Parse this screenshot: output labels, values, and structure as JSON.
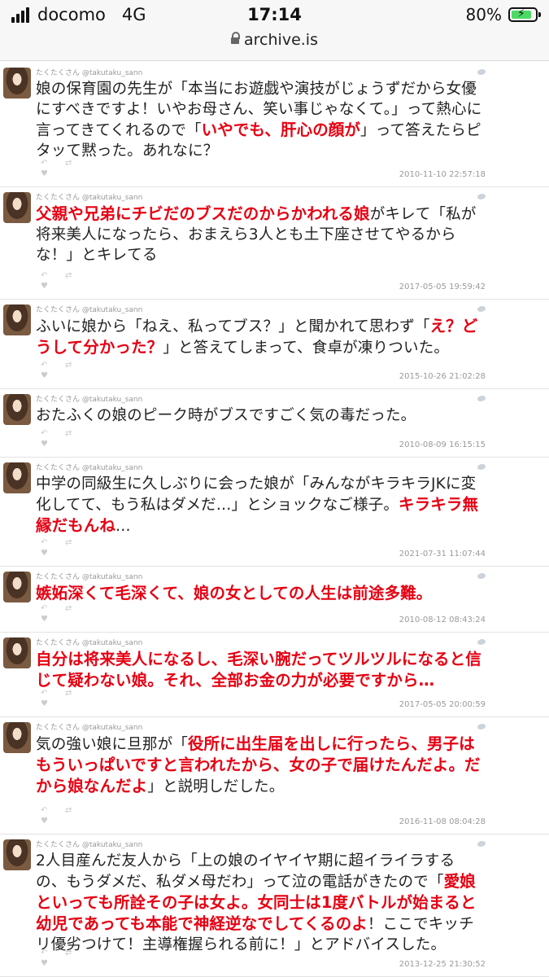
{
  "status": {
    "carrier": "docomo",
    "network": "4G",
    "time": "17:14",
    "battery": "80%"
  },
  "url": "archive.is",
  "author": "たくたくさん @takutaku_sann",
  "tweets": [
    {
      "segments": [
        {
          "t": "娘の保育園の先生が「本当にお遊戯や演技がじょうずだから女優にすべきですよ！いやお母さん、笑い事じゃなくて。」って熱心に言ってきてくれるので「",
          "r": false
        },
        {
          "t": "いやでも、肝心の顔が",
          "r": true
        },
        {
          "t": "」って答えたらピタッて黙った。あれなに？",
          "r": false
        }
      ],
      "time": "2010-11-10 22:57:18"
    },
    {
      "segments": [
        {
          "t": "父親や兄弟にチビだのブスだのからかわれる娘",
          "r": true
        },
        {
          "t": "がキレて「私が将来美人になったら、おまえら3人とも土下座させてやるからな！」とキレてる",
          "r": false
        }
      ],
      "time": "2017-05-05 19:59:42"
    },
    {
      "segments": [
        {
          "t": "ふいに娘から「ねえ、私ってブス？」と聞かれて思わず「",
          "r": false
        },
        {
          "t": "え？どうして分かった？",
          "r": true
        },
        {
          "t": "」と答えてしまって、食卓が凍りついた。",
          "r": false
        }
      ],
      "time": "2015-10-26 21:02:28"
    },
    {
      "segments": [
        {
          "t": "おたふくの娘のピーク時がブスですごく気の毒だった。",
          "r": false
        }
      ],
      "time": "2010-08-09 16:15:15"
    },
    {
      "segments": [
        {
          "t": "中学の同級生に久しぶりに会った娘が「みんながキラキラJKに変化してて、もう私はダメだ…」とショックなご様子。",
          "r": false
        },
        {
          "t": "キラキラ無縁だもんね",
          "r": true
        },
        {
          "t": "…",
          "r": false
        }
      ],
      "time": "2021-07-31 11:07:44"
    },
    {
      "segments": [
        {
          "t": "嫉妬深くて毛深くて、娘の女としての人生は前途多難。",
          "r": true
        }
      ],
      "time": "2010-08-12 08:43:24"
    },
    {
      "segments": [
        {
          "t": "自分は将来美人になるし、毛深い腕だってツルツルになると信じて疑わない娘。それ、全部お金の力が必要ですから…",
          "r": true
        }
      ],
      "time": "2017-05-05 20:00:59"
    },
    {
      "segments": [
        {
          "t": "気の強い娘に旦那が「",
          "r": false
        },
        {
          "t": "役所に出生届を出しに行ったら、男子はもういっぱいですと言われたから、女の子で届けたんだよ。だから娘なんだよ",
          "r": true
        },
        {
          "t": "」と説明しだした。",
          "r": false
        }
      ],
      "time": "2016-11-08 08:04:28"
    },
    {
      "segments": [
        {
          "t": "2人目産んだ友人から「上の娘のイヤイヤ期に超イライラするの、もうダメだ、私ダメ母だわ」って泣の電話がきたので「",
          "r": false
        },
        {
          "t": "愛娘といっても所詮その子は女よ。女同士は1度バトルが始まると幼児であっても本能で神経逆なでしてくるのよ",
          "r": true
        },
        {
          "t": "！ここでキッチリ優劣つけて！主導権握られる前に！」とアドバイスした。",
          "r": false
        }
      ],
      "time": "2013-12-25 21:30:52"
    }
  ]
}
